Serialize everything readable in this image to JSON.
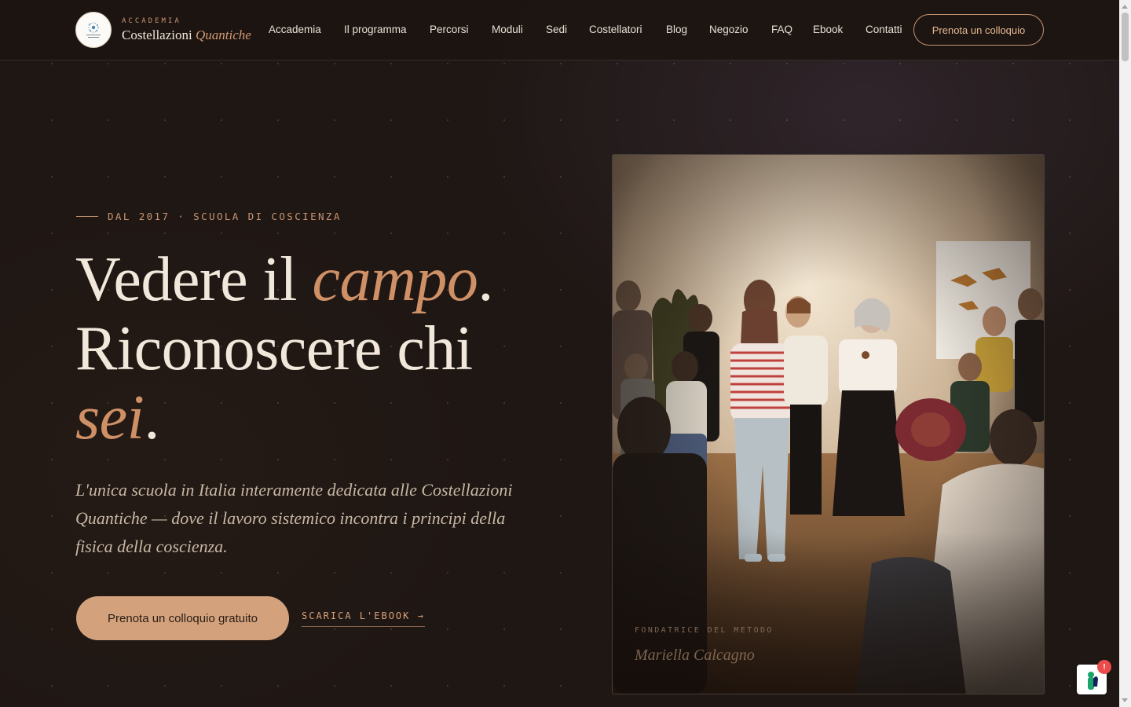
{
  "brand": {
    "eyebrow": "ACCADEMIA",
    "name": "Costellazioni",
    "name_accent": "Quantiche",
    "logo_icon": "quantum-constellation-logo"
  },
  "nav": {
    "items": [
      "Accademia",
      "Il programma",
      "Percorsi",
      "Moduli",
      "Sedi",
      "Costellatori",
      "Blog",
      "Negozio",
      "FAQ",
      "Ebook",
      "Contatti"
    ],
    "cta_label": "Prenota un colloquio"
  },
  "hero": {
    "eyebrow": "DAL 2017 · SCUOLA DI COSCIENZA",
    "headline": {
      "line1_a": "Vedere il ",
      "line1_accent": "campo",
      "line1_b": ".",
      "line2": "Riconoscere chi",
      "line3_accent": "sei",
      "line3_b": "."
    },
    "lead": "L'unica scuola in Italia interamente dedicata alle Costellazioni Quantiche — dove il lavoro sistemico incontra i principi della fisica della coscienza.",
    "cta_primary": "Prenota un colloquio gratuito",
    "cta_secondary": "SCARICA L'EBOOK →"
  },
  "photo": {
    "caption_label": "FONDATRICE DEL METODO",
    "caption_name": "Mariella Calcagno"
  },
  "chat_widget": {
    "icon": "chat-assistant-icon",
    "badge": "!"
  },
  "colors": {
    "accent": "#c99470",
    "background": "#1f1714",
    "cta_fill": "#d3a27c",
    "text": "#efe6d8"
  }
}
